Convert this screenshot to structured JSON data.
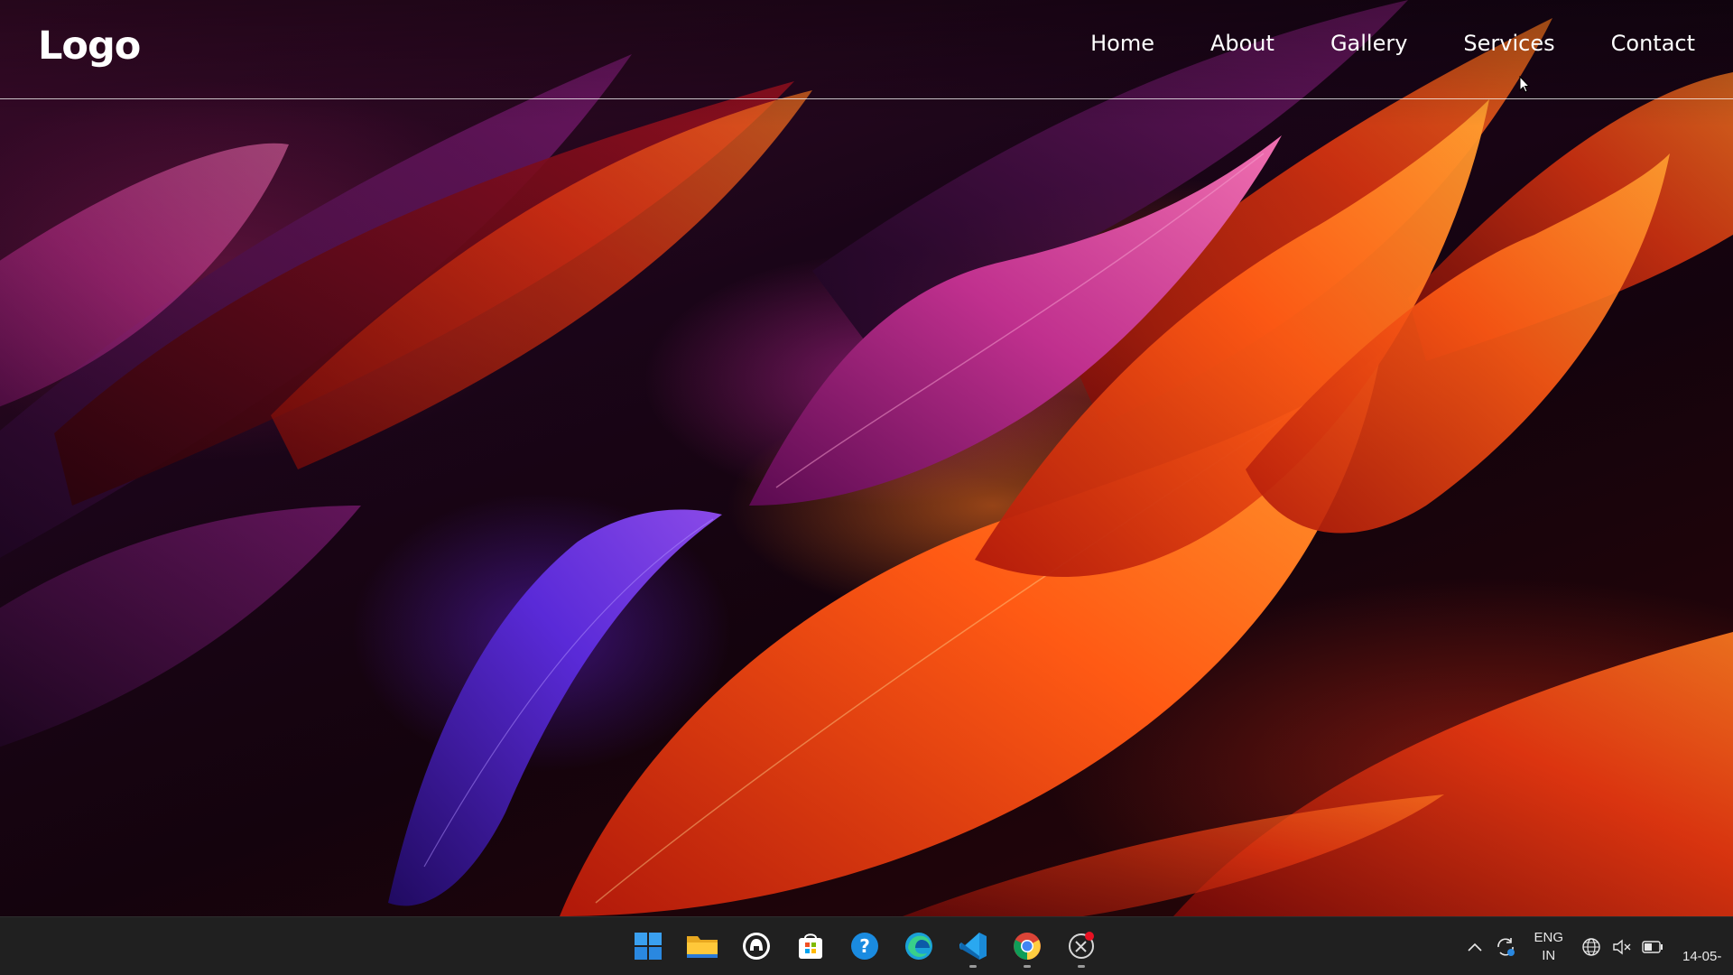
{
  "site": {
    "logo": "Logo",
    "nav": [
      "Home",
      "About",
      "Gallery",
      "Services",
      "Contact"
    ]
  },
  "taskbar": {
    "apps": [
      {
        "name": "start-menu-icon",
        "running": false
      },
      {
        "name": "file-explorer-icon",
        "running": false
      },
      {
        "name": "sound-recorder-icon",
        "running": false
      },
      {
        "name": "microsoft-store-icon",
        "running": false
      },
      {
        "name": "help-icon",
        "running": false
      },
      {
        "name": "edge-browser-icon",
        "running": false
      },
      {
        "name": "vscode-icon",
        "running": true
      },
      {
        "name": "chrome-icon",
        "running": true
      },
      {
        "name": "snipping-tool-icon",
        "running": true
      }
    ],
    "tray": {
      "lang_top": "ENG",
      "lang_bottom": "IN",
      "clock_date": "14-05-"
    }
  },
  "colors": {
    "nav_text": "#ffffff",
    "taskbar_bg": "#202020",
    "accent_orange": "#ff6a1a",
    "accent_magenta": "#c8309a",
    "accent_violet": "#5a28d0"
  }
}
